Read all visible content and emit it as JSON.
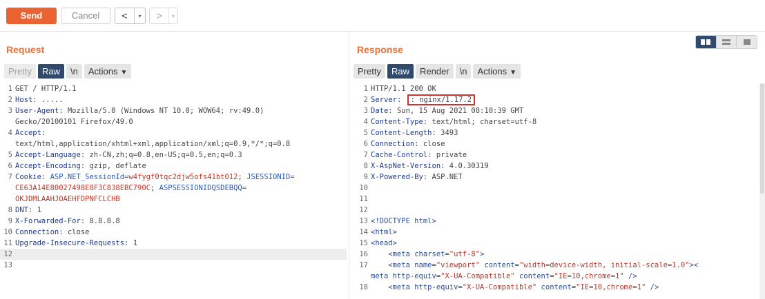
{
  "toolbar": {
    "send_label": "Send",
    "cancel_label": "Cancel",
    "back_glyph": "<",
    "forward_glyph": ">",
    "dropdown_glyph": "▾"
  },
  "request": {
    "title": "Request",
    "tabs": [
      {
        "label": "Pretty",
        "state": "disabled"
      },
      {
        "label": "Raw",
        "state": "active"
      },
      {
        "label": "\\n",
        "state": "normal"
      },
      {
        "label": "Actions",
        "state": "normal"
      }
    ],
    "lines": {
      "l1": "GET / HTTP/1.1",
      "l2k": "Host",
      "l2v": ": .....",
      "l3k": "User-Agent",
      "l3v": ": Mozilla/5.0 (Windows NT 10.0; WOW64; rv:49.0)",
      "l3w": "Gecko/20100101 Firefox/49.0",
      "l4k": "Accept",
      "l4v": ":",
      "l4w": "text/html,application/xhtml+xml,application/xml;q=0.9,*/*;q=0.8",
      "l5k": "Accept-Language",
      "l5v": ": zh-CN,zh;q=0.8,en-US;q=0.5,en;q=0.3",
      "l6k": "Accept-Encoding",
      "l6v": ": gzip, deflate",
      "l7k": "Cookie",
      "l7a": ": ",
      "l7b": "ASP.NET_SessionId",
      "l7c": "=w4fygf0tqc2djw5ofs41bt012",
      "l7d": "; ",
      "l7e": "JSESSIONID",
      "l7f": "=",
      "l7w1": "CE63A14E80027498E8F3C838EBC790C",
      "l7w1b": "; ",
      "l7w1c": "ASPSESSIONIDQSDEBQQ",
      "l7w1d": "=",
      "l7w2": "OKJDMLAAHJOAEHFDPNFCLCHB",
      "l8k": "DNT",
      "l8v": ": 1",
      "l9k": "X-Forwarded-For",
      "l9v": ": 8.8.8.8",
      "l10k": "Connection",
      "l10v": ": close",
      "l11k": "Upgrade-Insecure-Requests",
      "l11v": ": 1"
    },
    "line_numbers": [
      "1",
      "2",
      "3",
      "4",
      "5",
      "6",
      "7",
      "8",
      "9",
      "10",
      "11",
      "12",
      "13"
    ]
  },
  "response": {
    "title": "Response",
    "tabs": [
      {
        "label": "Pretty",
        "state": "normal"
      },
      {
        "label": "Raw",
        "state": "active"
      },
      {
        "label": "Render",
        "state": "normal"
      },
      {
        "label": "\\n",
        "state": "normal"
      },
      {
        "label": "Actions",
        "state": "normal"
      }
    ],
    "lines": {
      "l1": "HTTP/1.1 200 OK",
      "l2k": "Server",
      "l2v": ": nginx/1.17.2",
      "l3k": "Date",
      "l3v": ": Sun, 15 Aug 2021 08:10:39 GMT",
      "l4k": "Content-Type",
      "l4v": ": text/html; charset=utf-8",
      "l5k": "Content-Length",
      "l5v": ": 3493",
      "l6k": "Connection",
      "l6v": ": close",
      "l7k": "Cache-Control",
      "l7v": ": private",
      "l8k": "X-AspNet-Version",
      "l8v": ": 4.0.30319",
      "l9k": "X-Powered-By",
      "l9v": ": ASP.NET",
      "l13": "<!DOCTYPE html>",
      "l14": "<html>",
      "l15": "<head>",
      "l16a": "    <meta ",
      "l16b": "charset",
      "l16c": "=",
      "l16d": "\"utf-8\"",
      "l16e": ">",
      "l17a": "    <meta ",
      "l17b": "name",
      "l17c": "=",
      "l17d": "\"viewport\"",
      "l17e": " content",
      "l17f": "=",
      "l17g": "\"width=device-width, initial-scale=1.0\"",
      "l17h": "><",
      "l17wa": "meta ",
      "l17wb": "http-equiv",
      "l17wc": "=",
      "l17wd": "\"X-UA-Compatible\"",
      "l17we": " content",
      "l17wf": "=",
      "l17wg": "\"IE=10,chrome=1\"",
      "l17wh": " />",
      "l18a": "    <meta ",
      "l18b": "http-equiv",
      "l18c": "=",
      "l18d": "\"X-UA-Compatible\"",
      "l18e": " content",
      "l18f": "=",
      "l18g": "\"IE=10,chrome=1\"",
      "l18h": " />"
    },
    "line_numbers": [
      "1",
      "2",
      "3",
      "4",
      "5",
      "6",
      "7",
      "8",
      "9",
      "10",
      "11",
      "12",
      "13",
      "14",
      "15",
      "16",
      "17",
      "18"
    ]
  },
  "layout_modes": [
    "split-columns-icon",
    "split-rows-icon",
    "single-pane-icon"
  ],
  "colors": {
    "accent": "#ec6333",
    "active_tab": "#2f4a6d",
    "highlight": "#d0342c"
  }
}
